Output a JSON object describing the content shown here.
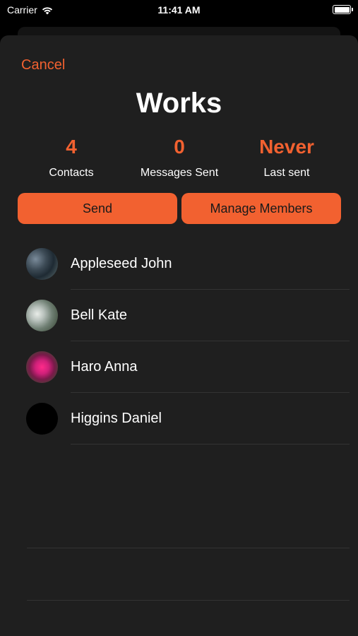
{
  "status_bar": {
    "carrier": "Carrier",
    "time": "11:41 AM"
  },
  "header": {
    "cancel_label": "Cancel",
    "title": "Works"
  },
  "stats": [
    {
      "value": "4",
      "label": "Contacts"
    },
    {
      "value": "0",
      "label": "Messages Sent"
    },
    {
      "value": "Never",
      "label": "Last sent"
    }
  ],
  "actions": {
    "send_label": "Send",
    "manage_label": "Manage Members"
  },
  "contacts": [
    {
      "name": "Appleseed John"
    },
    {
      "name": "Bell Kate"
    },
    {
      "name": "Haro Anna"
    },
    {
      "name": "Higgins Daniel"
    }
  ],
  "colors": {
    "accent": "#f26130",
    "sheet_bg": "#1f1f1f",
    "separator": "#333333"
  }
}
